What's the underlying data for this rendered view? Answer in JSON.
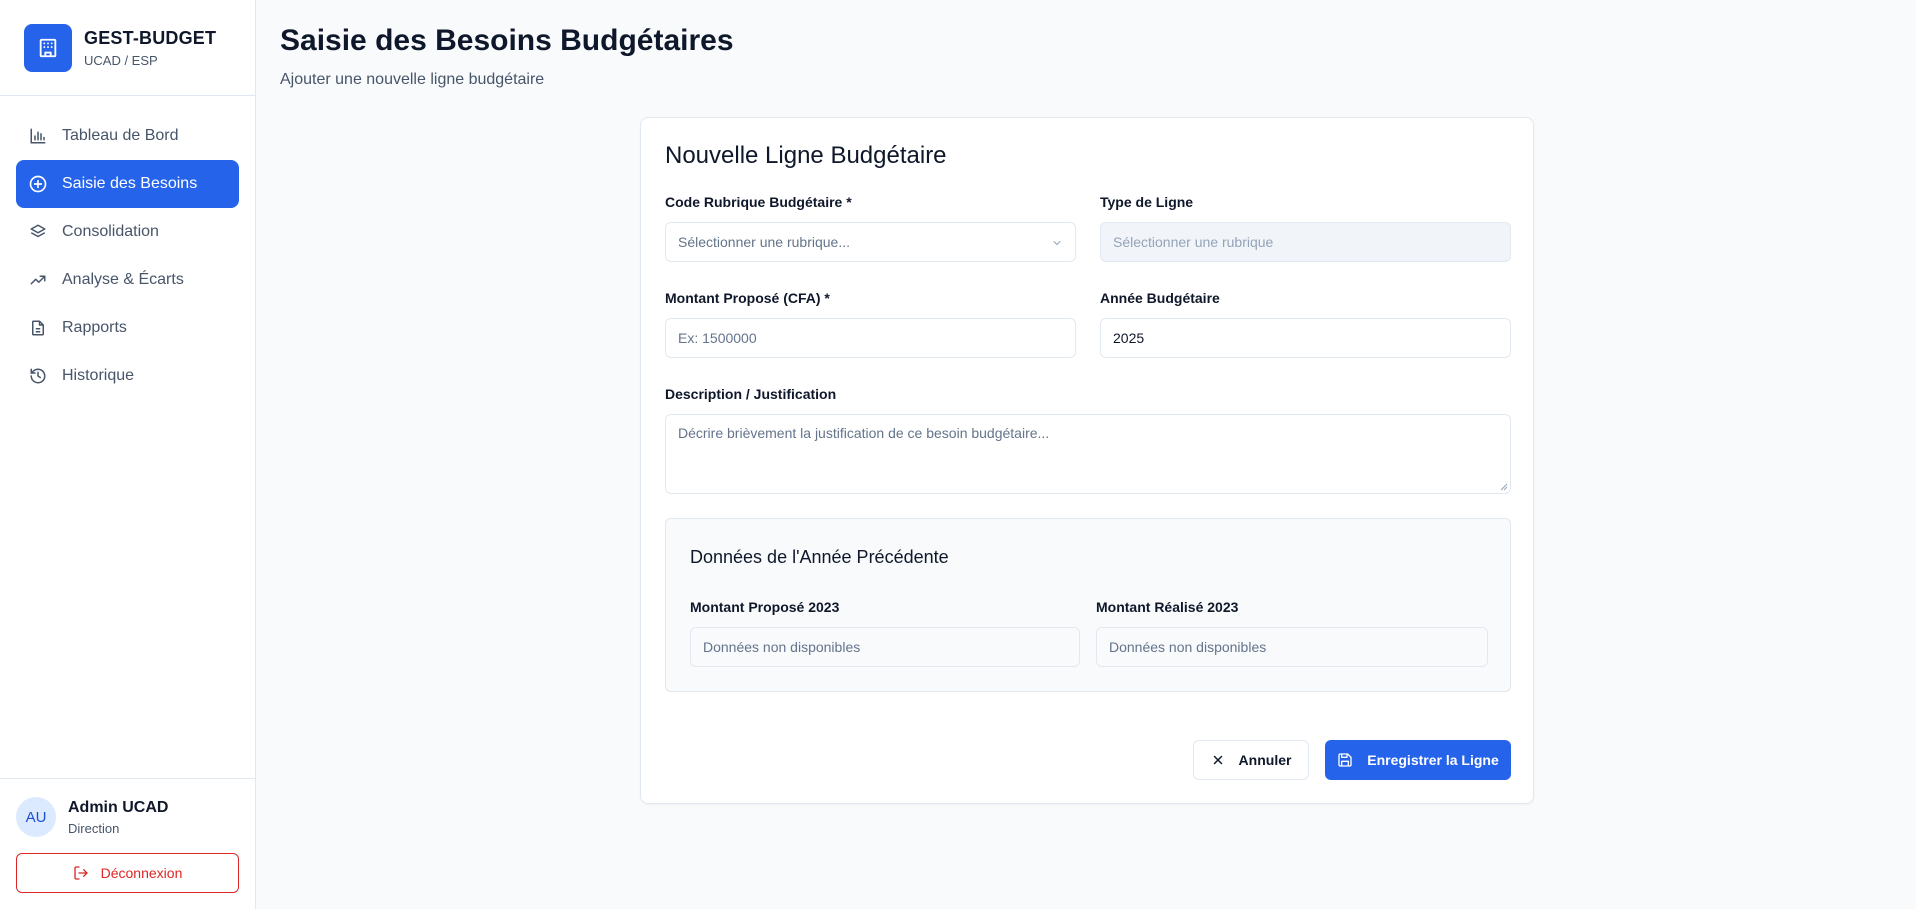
{
  "brand": {
    "title": "GEST-BUDGET",
    "subtitle": "UCAD / ESP",
    "logo_icon": "building-icon",
    "color": "#2563eb"
  },
  "sidebar": {
    "items": [
      {
        "label": "Tableau de Bord",
        "icon": "bar-chart-icon",
        "active": false
      },
      {
        "label": "Saisie des Besoins",
        "icon": "plus-circle-icon",
        "active": true
      },
      {
        "label": "Consolidation",
        "icon": "layers-icon",
        "active": false
      },
      {
        "label": "Analyse & Écarts",
        "icon": "trending-up-icon",
        "active": false
      },
      {
        "label": "Rapports",
        "icon": "file-text-icon",
        "active": false
      },
      {
        "label": "Historique",
        "icon": "history-icon",
        "active": false
      }
    ]
  },
  "user": {
    "initials": "AU",
    "name": "Admin UCAD",
    "role": "Direction",
    "logout_label": "Déconnexion"
  },
  "header": {
    "title": "Saisie des Besoins Budgétaires",
    "subtitle": "Ajouter une nouvelle ligne budgétaire"
  },
  "form": {
    "title": "Nouvelle Ligne Budgétaire",
    "rubrique": {
      "label": "Code Rubrique Budgétaire *",
      "placeholder": "Sélectionner une rubrique..."
    },
    "type_ligne": {
      "label": "Type de Ligne",
      "placeholder": "Sélectionner une rubrique"
    },
    "montant": {
      "label": "Montant Proposé (CFA) *",
      "placeholder": "Ex: 1500000"
    },
    "annee": {
      "label": "Année Budgétaire",
      "value": "2025"
    },
    "description": {
      "label": "Description / Justification",
      "placeholder": "Décrire brièvement la justification de ce besoin budgétaire..."
    },
    "previous": {
      "title": "Données de l'Année Précédente",
      "propose_label": "Montant Proposé 2023",
      "propose_placeholder": "Données non disponibles",
      "realise_label": "Montant Réalisé 2023",
      "realise_placeholder": "Données non disponibles"
    },
    "cancel_label": "Annuler",
    "save_label": "Enregistrer la Ligne"
  },
  "colors": {
    "accent": "#2563eb",
    "danger": "#dc2626",
    "text": "#0f172a",
    "muted": "#475569"
  }
}
